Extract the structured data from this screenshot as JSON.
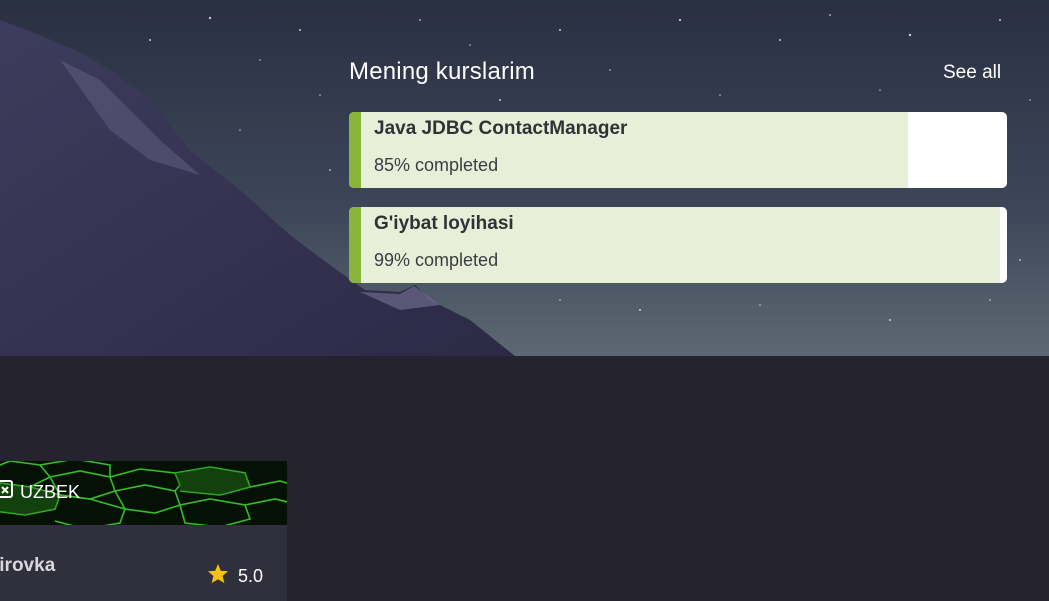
{
  "my_courses": {
    "title": "Mening kurslarim",
    "see_all": "See all",
    "items": [
      {
        "name": "Java JDBC ContactManager",
        "progress_label": "85% completed",
        "progress": 0.85
      },
      {
        "name": "G'iybat loyihasi",
        "progress_label": "99% completed",
        "progress": 0.99
      }
    ]
  },
  "featured_course": {
    "language": "UZBEK",
    "language_icon": "translate-icon",
    "title": "jirovka",
    "rating": "5.0",
    "rating_icon": "star-icon"
  },
  "colors": {
    "accent": "#8ab53a",
    "card_fill": "#e8efd9",
    "page_background": "#24232e",
    "star": "#f6c20f"
  }
}
